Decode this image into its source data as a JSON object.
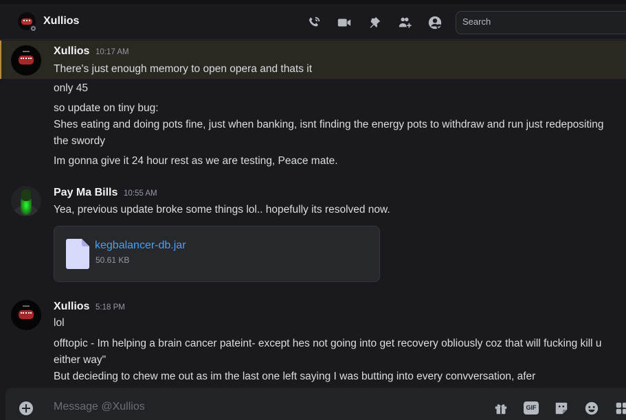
{
  "header": {
    "title": "Xullios",
    "icons": [
      "call-icon",
      "video-icon",
      "pin-icon",
      "add-friends-icon",
      "profile-icon"
    ],
    "search_placeholder": "Search"
  },
  "messages": [
    {
      "author": "Xullios",
      "timestamp": "10:17 AM",
      "lines": [
        "There's just enough memory to open opera and thats it",
        "only 45",
        "so update on tiny bug:",
        "Shes eating and doing pots fine, just when banking, isnt finding the energy pots to withdraw and run just redepositing the swordy",
        "Im gonna give it 24 hour rest as we are testing, Peace mate."
      ]
    },
    {
      "author": "Pay Ma Bills",
      "timestamp": "10:55 AM",
      "lines": [
        "Yea, previous update broke some things lol.. hopefully its resolved now."
      ],
      "attachment": {
        "name": "kegbalancer-db.jar",
        "size": "50.61 KB"
      }
    },
    {
      "author": "Xullios",
      "timestamp": "5:18 PM",
      "lines": [
        "lol",
        "offtopic - Im helping a brain cancer pateint- except hes not going into get recovery obliously coz that will fucking kill u either way\"",
        "But decieding to chew me out as im the last one left saying I was butting into every convversation, afer"
      ]
    }
  ],
  "composer": {
    "placeholder": "Message @Xullios",
    "gif_label": "GIF",
    "icons": [
      "add-icon",
      "gift-icon",
      "gif-icon",
      "sticker-icon",
      "emoji-icon",
      "apps-icon"
    ]
  },
  "colors": {
    "background": "#1a1a1e",
    "highlight": "#2b2721",
    "highlight_border": "#b88b3c",
    "link": "#4e9ff0"
  }
}
